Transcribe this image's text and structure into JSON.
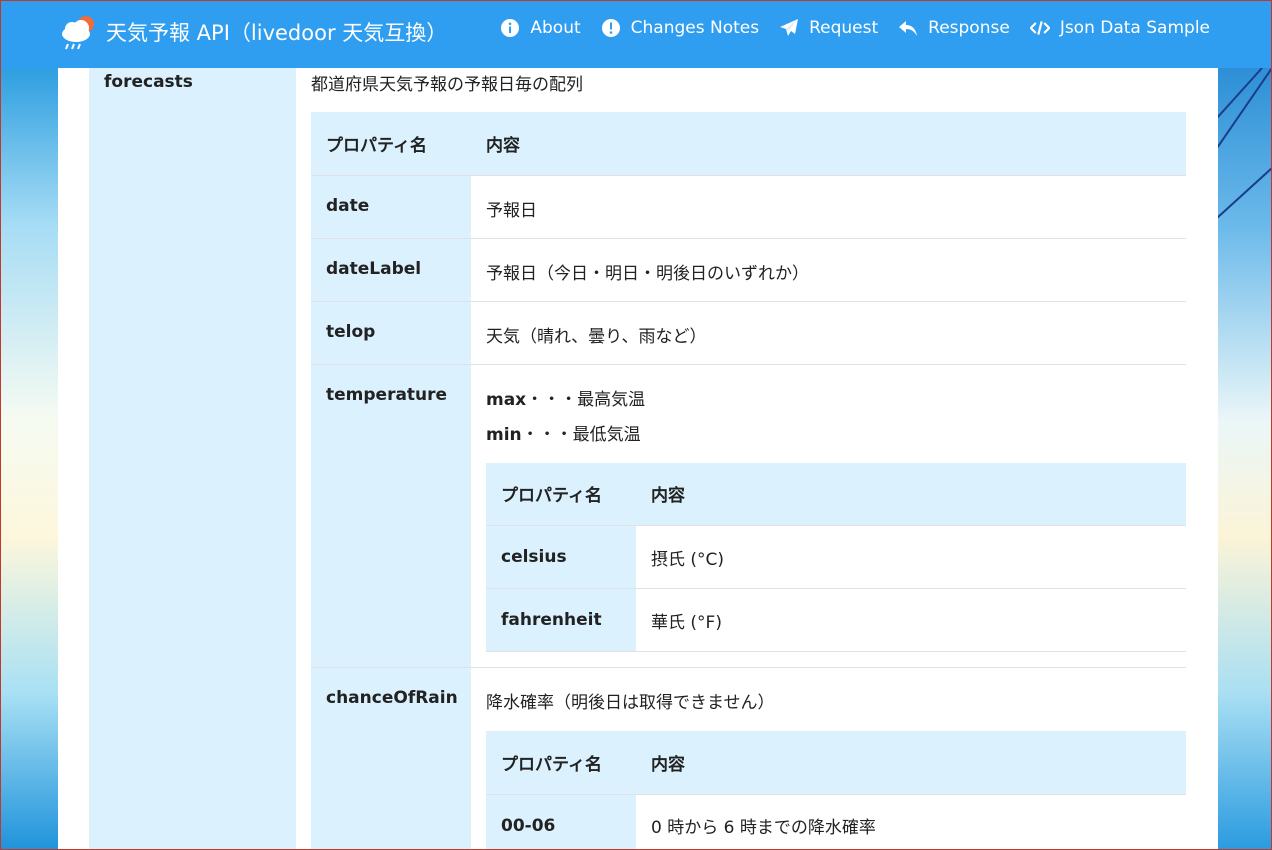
{
  "colors": {
    "navbar": "#2f9df0",
    "key_bg": "#dbf1fd"
  },
  "navbar": {
    "brand": "天気予報 API（livedoor 天気互換）",
    "items": [
      {
        "label": "About",
        "icon": "info-circle-icon"
      },
      {
        "label": "Changes Notes",
        "icon": "exclamation-circle-icon"
      },
      {
        "label": "Request",
        "icon": "paper-plane-icon"
      },
      {
        "label": "Response",
        "icon": "reply-icon"
      },
      {
        "label": "Json Data Sample",
        "icon": "code-icon"
      }
    ]
  },
  "main": {
    "key": "forecasts",
    "description": "都道府県天気予報の予報日毎の配列",
    "table": {
      "header": {
        "name": "プロパティ名",
        "content": "内容"
      },
      "rows": {
        "date": {
          "name": "date",
          "content": "予報日"
        },
        "dateLabel": {
          "name": "dateLabel",
          "content": "予報日（今日・明日・明後日のいずれか）"
        },
        "telop": {
          "name": "telop",
          "content": "天気（晴れ、曇り、雨など）"
        },
        "temperature": {
          "name": "temperature",
          "line1_key": "max",
          "line1_text": "・・・最高気温",
          "line2_key": "min",
          "line2_text": "・・・最低気温",
          "sub": {
            "header": {
              "name": "プロパティ名",
              "content": "内容"
            },
            "rows": [
              {
                "name": "celsius",
                "content": "摂氏 (°C)"
              },
              {
                "name": "fahrenheit",
                "content": "華氏 (°F)"
              }
            ]
          }
        },
        "chanceOfRain": {
          "name": "chanceOfRain",
          "content": "降水確率（明後日は取得できません）",
          "sub": {
            "header": {
              "name": "プロパティ名",
              "content": "内容"
            },
            "rows": [
              {
                "name": "00-06",
                "content": "0 時から 6 時までの降水確率"
              }
            ]
          }
        }
      }
    }
  }
}
